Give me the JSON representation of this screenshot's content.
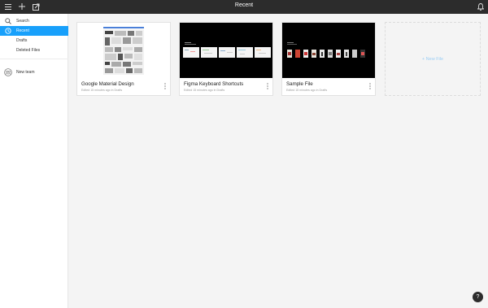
{
  "topbar": {
    "title": "Recent",
    "icons": [
      "menu-icon",
      "plus-icon",
      "import-icon",
      "bell-icon"
    ]
  },
  "sidebar": {
    "search_label": "Search",
    "items": [
      {
        "label": "Recent",
        "icon": "clock-icon",
        "active": true
      },
      {
        "label": "Drafts"
      },
      {
        "label": "Deleted Files"
      }
    ],
    "team_label": "New team"
  },
  "files": [
    {
      "name": "Google Material Design",
      "meta": "Edited 15 minutes ago in Drafts",
      "thumb": "light"
    },
    {
      "name": "Figma Keyboard Shortcuts",
      "meta": "Edited 15 minutes ago in Drafts",
      "thumb": "dark"
    },
    {
      "name": "Sample File",
      "meta": "Edited 15 minutes ago in Drafts",
      "thumb": "dark"
    }
  ],
  "new_file_label": "+ New File",
  "help_label": "?",
  "colors": {
    "accent": "#18a0fb",
    "topbar": "#2c2c2c",
    "background": "#f4f4f4"
  }
}
